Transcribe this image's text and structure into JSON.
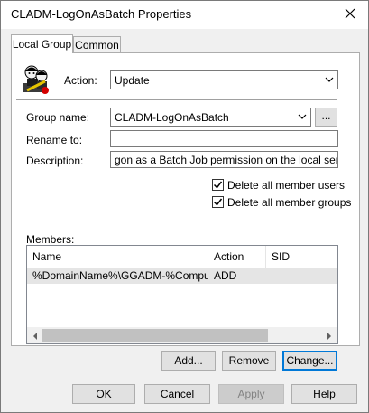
{
  "window": {
    "title": "CLADM-LogOnAsBatch Properties"
  },
  "tabs": [
    {
      "label": "Local Group"
    },
    {
      "label": "Common"
    }
  ],
  "form": {
    "action_label": "Action:",
    "action_value": "Update",
    "group_name_label": "Group name:",
    "group_name_value": "CLADM-LogOnAsBatch",
    "browse_label": "...",
    "rename_label": "Rename to:",
    "rename_value": "",
    "description_label": "Description:",
    "description_value": "gon as a Batch Job permission on the local server.",
    "delete_users_label": "Delete all member users",
    "delete_users_checked": true,
    "delete_groups_label": "Delete all member groups",
    "delete_groups_checked": true,
    "members_label": "Members:"
  },
  "members": {
    "columns": [
      "Name",
      "Action",
      "SID"
    ],
    "rows": [
      {
        "name": "%DomainName%\\GGADM-%Comput...",
        "action": "ADD",
        "sid": ""
      }
    ]
  },
  "member_buttons": {
    "add": "Add...",
    "remove": "Remove",
    "change": "Change..."
  },
  "dialog_buttons": {
    "ok": "OK",
    "cancel": "Cancel",
    "apply": "Apply",
    "help": "Help"
  },
  "colors": {
    "focus_border": "#0078d7",
    "selected_row": "#e5e5e5"
  }
}
